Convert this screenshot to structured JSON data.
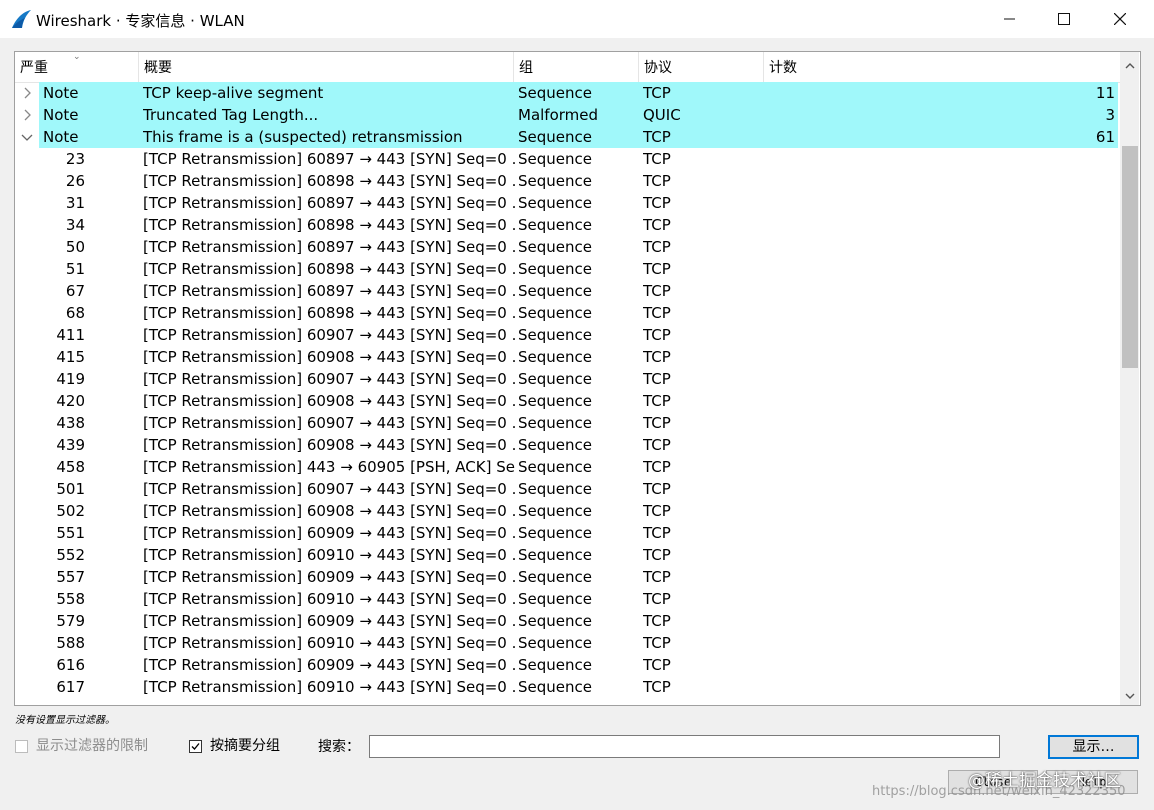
{
  "window": {
    "title": "Wireshark · 专家信息 · WLAN",
    "minimize_label": "—",
    "close_label": "✕"
  },
  "table": {
    "columns": [
      "严重",
      "概要",
      "组",
      "协议",
      "计数"
    ],
    "groups": [
      {
        "expanded": false,
        "expander": "›",
        "severity": "Note",
        "summary": "TCP keep-alive segment",
        "group": "Sequence",
        "protocol": "TCP",
        "count": "11"
      },
      {
        "expanded": false,
        "expander": "›",
        "severity": "Note",
        "summary": "Truncated Tag Length...",
        "group": "Malformed",
        "protocol": "QUIC",
        "count": "3"
      },
      {
        "expanded": true,
        "expander": "⌄",
        "severity": "Note",
        "summary": "This frame is a (suspected) retransmission",
        "group": "Sequence",
        "protocol": "TCP",
        "count": "61"
      }
    ],
    "children": [
      {
        "num": "23",
        "summary": "[TCP Retransmission] 60897 → 443 [SYN] Seq=0 ...",
        "group": "Sequence",
        "protocol": "TCP"
      },
      {
        "num": "26",
        "summary": "[TCP Retransmission] 60898 → 443 [SYN] Seq=0 ...",
        "group": "Sequence",
        "protocol": "TCP"
      },
      {
        "num": "31",
        "summary": "[TCP Retransmission] 60897 → 443 [SYN] Seq=0 ...",
        "group": "Sequence",
        "protocol": "TCP"
      },
      {
        "num": "34",
        "summary": "[TCP Retransmission] 60898 → 443 [SYN] Seq=0 ...",
        "group": "Sequence",
        "protocol": "TCP"
      },
      {
        "num": "50",
        "summary": "[TCP Retransmission] 60897 → 443 [SYN] Seq=0 ...",
        "group": "Sequence",
        "protocol": "TCP"
      },
      {
        "num": "51",
        "summary": "[TCP Retransmission] 60898 → 443 [SYN] Seq=0 ...",
        "group": "Sequence",
        "protocol": "TCP"
      },
      {
        "num": "67",
        "summary": "[TCP Retransmission] 60897 → 443 [SYN] Seq=0 ...",
        "group": "Sequence",
        "protocol": "TCP"
      },
      {
        "num": "68",
        "summary": "[TCP Retransmission] 60898 → 443 [SYN] Seq=0 ...",
        "group": "Sequence",
        "protocol": "TCP"
      },
      {
        "num": "411",
        "summary": "[TCP Retransmission] 60907 → 443 [SYN] Seq=0 ...",
        "group": "Sequence",
        "protocol": "TCP"
      },
      {
        "num": "415",
        "summary": "[TCP Retransmission] 60908 → 443 [SYN] Seq=0 ...",
        "group": "Sequence",
        "protocol": "TCP"
      },
      {
        "num": "419",
        "summary": "[TCP Retransmission] 60907 → 443 [SYN] Seq=0 ...",
        "group": "Sequence",
        "protocol": "TCP"
      },
      {
        "num": "420",
        "summary": "[TCP Retransmission] 60908 → 443 [SYN] Seq=0 ...",
        "group": "Sequence",
        "protocol": "TCP"
      },
      {
        "num": "438",
        "summary": "[TCP Retransmission] 60907 → 443 [SYN] Seq=0 ...",
        "group": "Sequence",
        "protocol": "TCP"
      },
      {
        "num": "439",
        "summary": "[TCP Retransmission] 60908 → 443 [SYN] Seq=0 ...",
        "group": "Sequence",
        "protocol": "TCP"
      },
      {
        "num": "458",
        "summary": "[TCP Retransmission] 443 → 60905 [PSH, ACK] Se...",
        "group": "Sequence",
        "protocol": "TCP"
      },
      {
        "num": "501",
        "summary": "[TCP Retransmission] 60907 → 443 [SYN] Seq=0 ...",
        "group": "Sequence",
        "protocol": "TCP"
      },
      {
        "num": "502",
        "summary": "[TCP Retransmission] 60908 → 443 [SYN] Seq=0 ...",
        "group": "Sequence",
        "protocol": "TCP"
      },
      {
        "num": "551",
        "summary": "[TCP Retransmission] 60909 → 443 [SYN] Seq=0 ...",
        "group": "Sequence",
        "protocol": "TCP"
      },
      {
        "num": "552",
        "summary": "[TCP Retransmission] 60910 → 443 [SYN] Seq=0 ...",
        "group": "Sequence",
        "protocol": "TCP"
      },
      {
        "num": "557",
        "summary": "[TCP Retransmission] 60909 → 443 [SYN] Seq=0 ...",
        "group": "Sequence",
        "protocol": "TCP"
      },
      {
        "num": "558",
        "summary": "[TCP Retransmission] 60910 → 443 [SYN] Seq=0 ...",
        "group": "Sequence",
        "protocol": "TCP"
      },
      {
        "num": "579",
        "summary": "[TCP Retransmission] 60909 → 443 [SYN] Seq=0 ...",
        "group": "Sequence",
        "protocol": "TCP"
      },
      {
        "num": "588",
        "summary": "[TCP Retransmission] 60910 → 443 [SYN] Seq=0 ...",
        "group": "Sequence",
        "protocol": "TCP"
      },
      {
        "num": "616",
        "summary": "[TCP Retransmission] 60909 → 443 [SYN] Seq=0 ...",
        "group": "Sequence",
        "protocol": "TCP"
      },
      {
        "num": "617",
        "summary": "[TCP Retransmission] 60910 → 443 [SYN] Seq=0 ...",
        "group": "Sequence",
        "protocol": "TCP"
      }
    ]
  },
  "status_text": "没有设置显示过滤器。",
  "controls": {
    "limit_filter_label": "显示过滤器的限制",
    "limit_filter_checked": false,
    "group_by_summary_label": "按摘要分组",
    "group_by_summary_checked": true,
    "search_label": "搜索：",
    "search_value": "",
    "show_button": "显示…",
    "close_button": "Close",
    "help_button": "Help"
  },
  "watermark": {
    "primary": "@稀土掘金技术社区",
    "secondary": "https://blog.csdn.net/weixin_42322350"
  },
  "colors": {
    "group_highlight": "#a0f8fa",
    "focus_border": "#0078d7"
  }
}
